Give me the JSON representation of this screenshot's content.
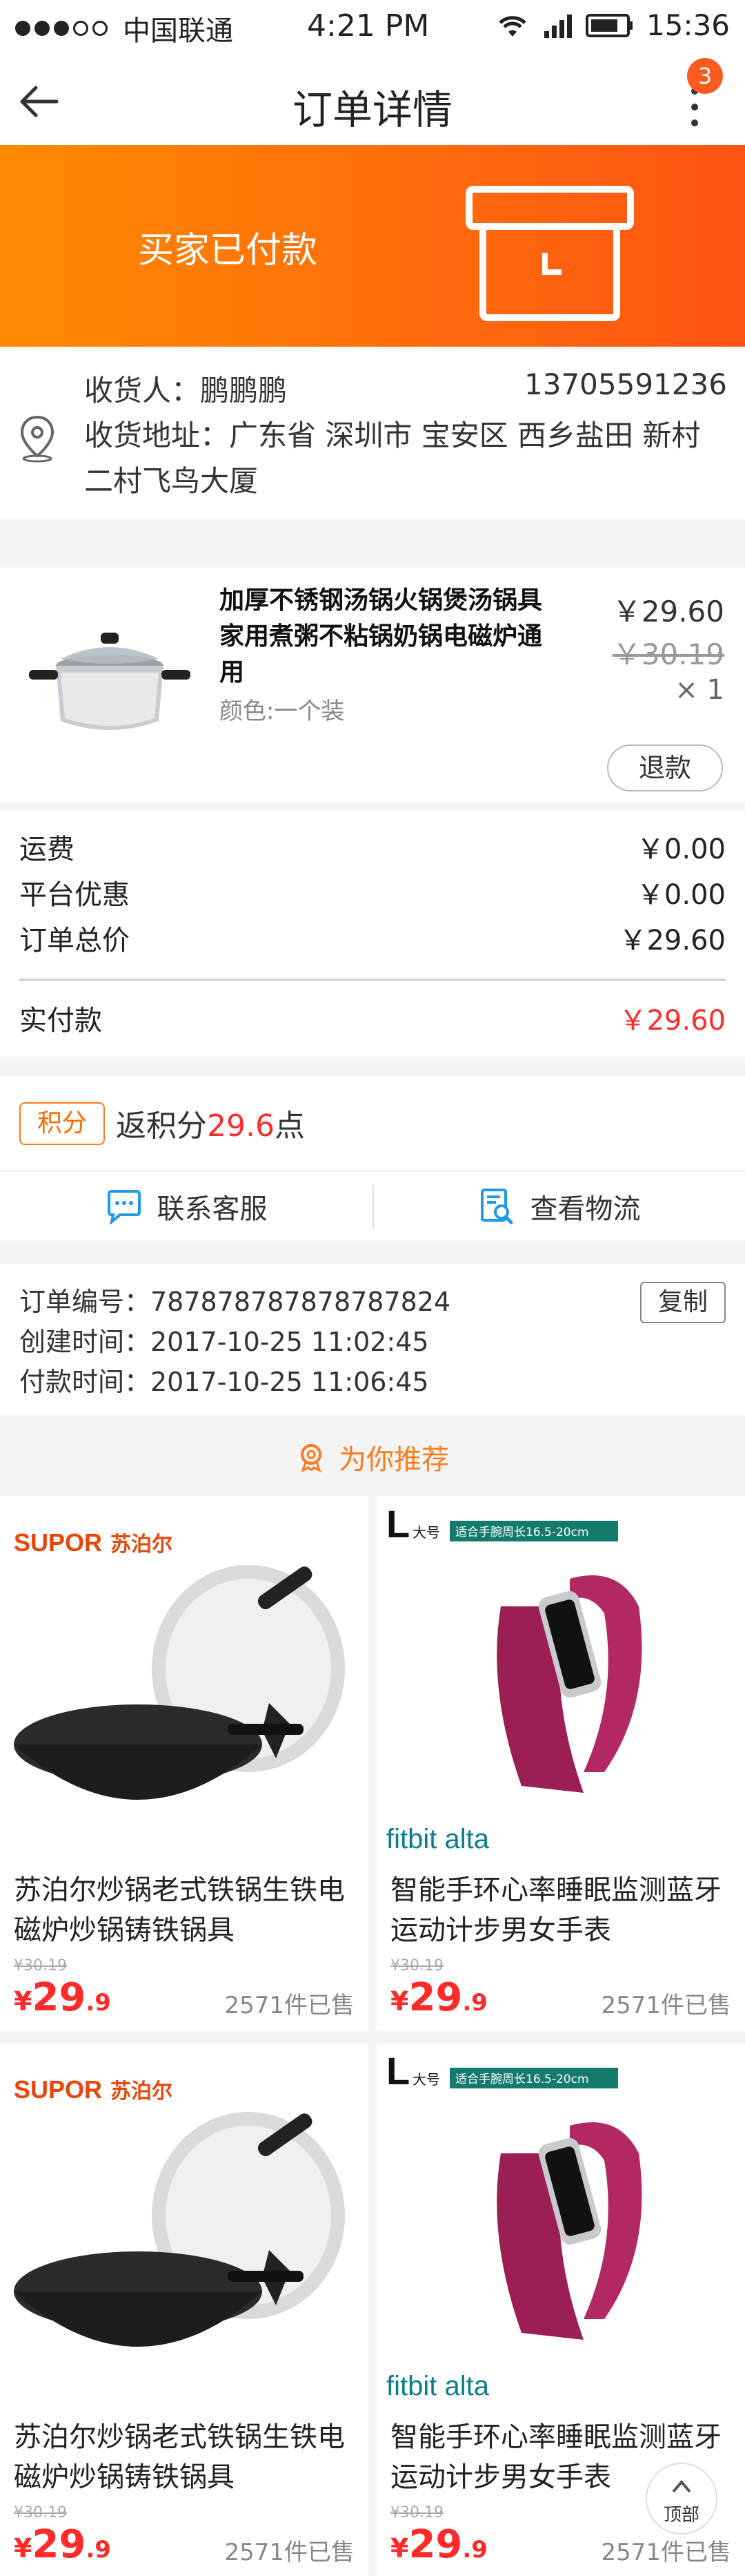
{
  "status_bar": {
    "carrier": "中国联通",
    "time": "4:21 PM",
    "clock": "15:36"
  },
  "nav": {
    "title": "订单详情",
    "badge": "3"
  },
  "banner": {
    "status": "买家已付款"
  },
  "address": {
    "name_label": "收货人：鹏鹏鹏",
    "phone": "13705591236",
    "addr": "收货地址：广东省 深圳市 宝安区 西乡盐田 新村二村飞鸟大厦"
  },
  "product": {
    "name": "加厚不锈钢汤锅火锅煲汤锅具家用煮粥不粘锅奶锅电磁炉通用",
    "spec": "颜色:一个装",
    "price": "￥29.60",
    "original_price": "￥30.19",
    "qty": "× 1",
    "refund": "退款"
  },
  "fees": {
    "shipping_label": "运费",
    "shipping": "￥0.00",
    "discount_label": "平台优惠",
    "discount": "￥0.00",
    "total_label": "订单总价",
    "total": "￥29.60",
    "paid_label": "实付款",
    "paid": "￥29.60"
  },
  "points": {
    "tag": "积分",
    "text_prefix": "返积分",
    "value": "29.6",
    "text_suffix": "点"
  },
  "service": {
    "contact": "联系客服",
    "logistics": "查看物流"
  },
  "order_info": {
    "number": "订单编号：787878787878787824",
    "created": "创建时间：2017-10-25  11:02:45",
    "paid": "付款时间：2017-10-25  11:06:45",
    "copy": "复制"
  },
  "recommend": {
    "title": "为你推荐",
    "items": [
      {
        "brand": "SUPOR",
        "brand_cn": "苏泊尔",
        "title": "苏泊尔炒锅老式铁锅生铁电磁炉炒锅铸铁锅具",
        "old_price": "¥30.19",
        "cur": "¥",
        "int": "29",
        "dec": ".9",
        "sold": "2571件已售"
      },
      {
        "brand": "fitbit alta",
        "size": "L",
        "size_cn": "大号",
        "size_tag": "适合手腕周长16.5-20cm",
        "title": "智能手环心率睡眠监测蓝牙运动计步男女手表",
        "old_price": "¥30.19",
        "cur": "¥",
        "int": "29",
        "dec": ".9",
        "sold": "2571件已售"
      },
      {
        "brand": "SUPOR",
        "brand_cn": "苏泊尔",
        "title": "苏泊尔炒锅老式铁锅生铁电磁炉炒锅铸铁锅具",
        "old_price": "¥30.19",
        "cur": "¥",
        "int": "29",
        "dec": ".9",
        "sold": "2571件已售"
      },
      {
        "brand": "fitbit alta",
        "size": "L",
        "size_cn": "大号",
        "size_tag": "适合手腕周长16.5-20cm",
        "title": "智能手环心率睡眠监测蓝牙运动计步男女手表",
        "old_price": "¥30.19",
        "cur": "¥",
        "int": "29",
        "dec": ".9",
        "sold": "2571件已售"
      }
    ]
  },
  "top_button": "顶部",
  "colors": {
    "accent": "#ff6a00",
    "price_red": "#ff2a2a",
    "banner_start": "#ff8a00",
    "banner_end": "#ff5414"
  }
}
